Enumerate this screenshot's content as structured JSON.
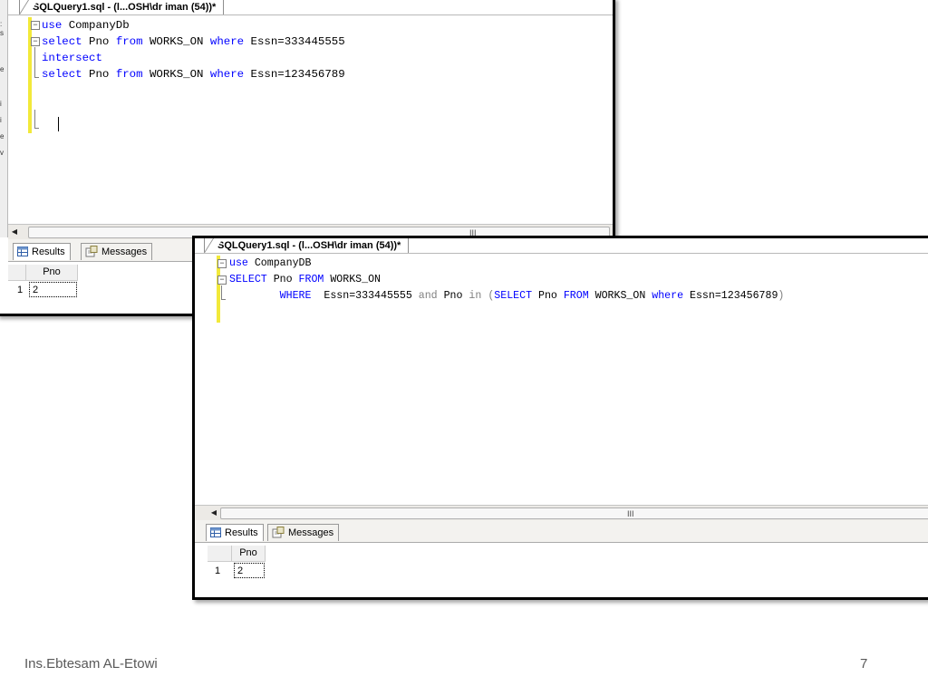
{
  "window_back": {
    "tab_title": "SQLQuery1.sql - (l...OSH\\dr iman (54))*",
    "code_lines": [
      [
        {
          "t": "use",
          "k": 1
        },
        {
          "t": " CompanyDb",
          "k": 0
        }
      ],
      [
        {
          "t": "select",
          "k": 1
        },
        {
          "t": " Pno ",
          "k": 0
        },
        {
          "t": "from",
          "k": 1
        },
        {
          "t": " WORKS_ON ",
          "k": 0
        },
        {
          "t": "where",
          "k": 1
        },
        {
          "t": " Essn=333445555",
          "k": 0
        }
      ],
      [
        {
          "t": "intersect",
          "k": 1
        }
      ],
      [
        {
          "t": "select",
          "k": 1
        },
        {
          "t": " Pno ",
          "k": 0
        },
        {
          "t": "from",
          "k": 1
        },
        {
          "t": " WORKS_ON ",
          "k": 0
        },
        {
          "t": "where",
          "k": 1
        },
        {
          "t": " Essn=123456789",
          "k": 0
        }
      ]
    ],
    "scroll_grip": "III",
    "results_tab": "Results",
    "messages_tab": "Messages",
    "column": "Pno",
    "row_number": "1",
    "value": "2"
  },
  "window_front": {
    "tab_title": "SQLQuery1.sql - (l...OSH\\dr iman (54))*",
    "code_lines": [
      [
        {
          "t": "use",
          "k": 1
        },
        {
          "t": " CompanyDB",
          "k": 0
        }
      ],
      [
        {
          "t": "SELECT",
          "k": 1
        },
        {
          "t": " Pno ",
          "k": 0
        },
        {
          "t": "FROM",
          "k": 1
        },
        {
          "t": " WORKS_ON",
          "k": 0
        }
      ],
      [
        {
          "t": "        ",
          "k": 0
        },
        {
          "t": "WHERE",
          "k": 1
        },
        {
          "t": "  Essn=333445555 ",
          "k": 0
        },
        {
          "t": "and",
          "k": 2
        },
        {
          "t": " Pno ",
          "k": 0
        },
        {
          "t": "in",
          "k": 2
        },
        {
          "t": " ",
          "k": 0
        },
        {
          "t": "(",
          "k": 2
        },
        {
          "t": "SELECT",
          "k": 1
        },
        {
          "t": " Pno ",
          "k": 0
        },
        {
          "t": "FROM",
          "k": 1
        },
        {
          "t": " WORKS_ON ",
          "k": 0
        },
        {
          "t": "where",
          "k": 1
        },
        {
          "t": " Essn=123456789",
          "k": 0
        },
        {
          "t": ")",
          "k": 2
        }
      ]
    ],
    "scroll_grip": "III",
    "results_tab": "Results",
    "messages_tab": "Messages",
    "column": "Pno",
    "row_number": "1",
    "value": "2"
  },
  "footer": {
    "author": "Ins.Ebtesam AL-Etowi",
    "page_number": "7"
  },
  "colors": {
    "keyword": "#0000ff",
    "operator": "#808080",
    "change_bar": "#f2e93a"
  }
}
